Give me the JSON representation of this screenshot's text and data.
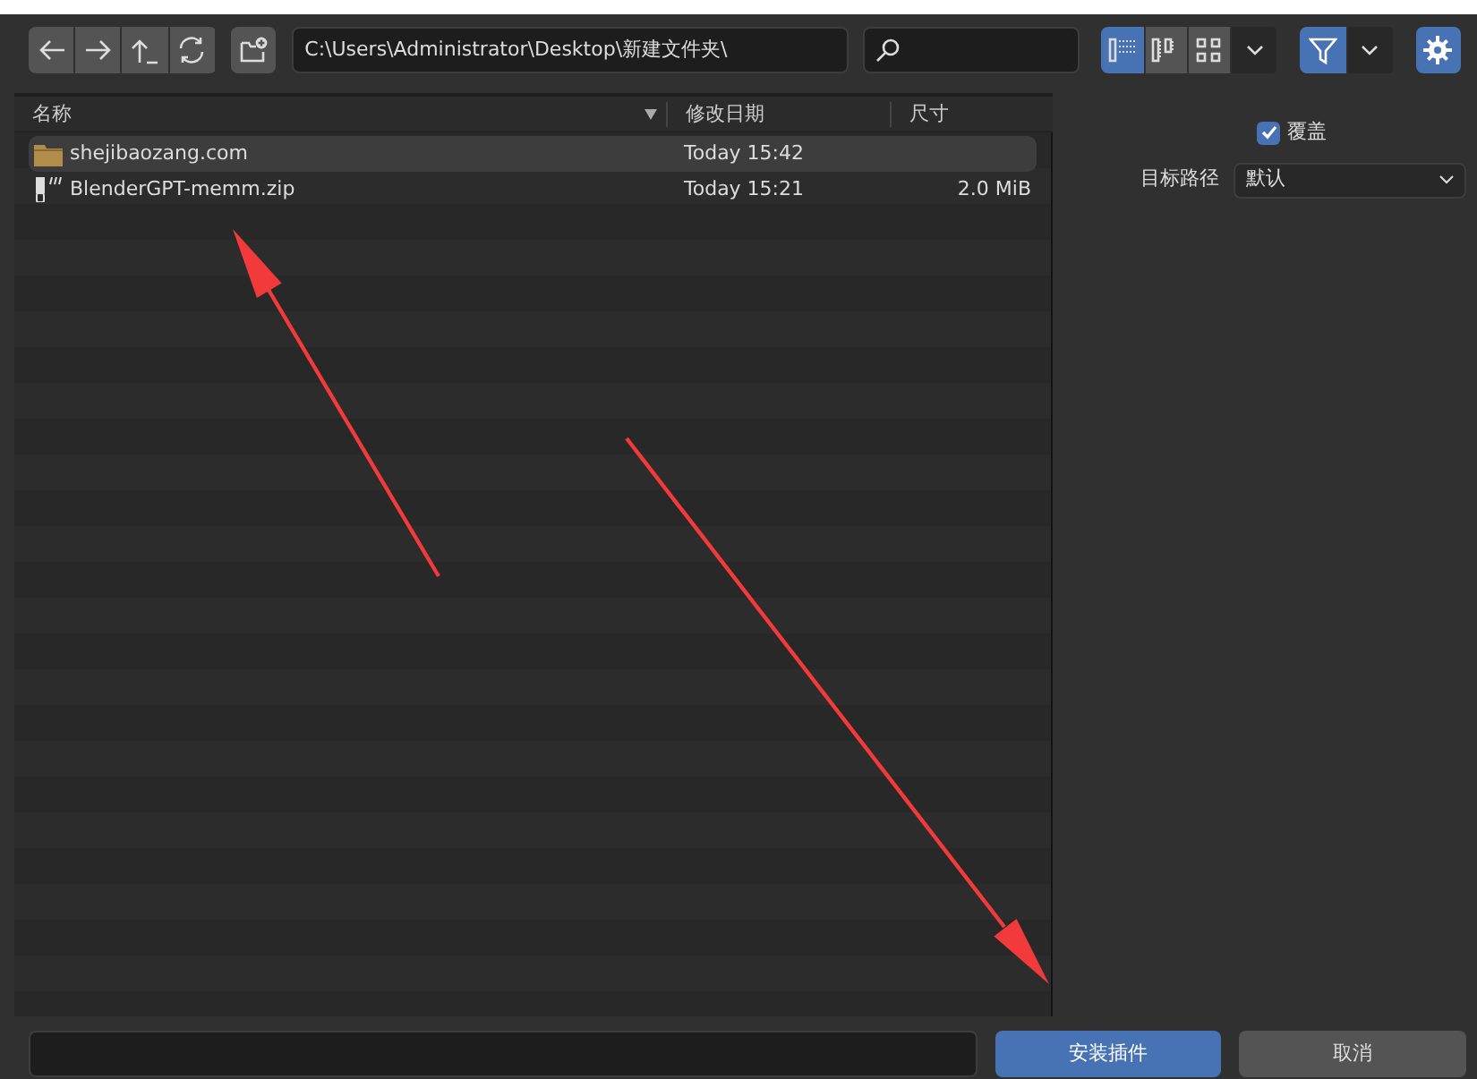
{
  "toolbar": {
    "path": "C:\\Users\\Administrator\\Desktop\\新建文件夹\\",
    "view_modes": [
      {
        "kind": "vertical-list",
        "selected": true
      },
      {
        "kind": "horizontal-list",
        "selected": false
      },
      {
        "kind": "thumbnails",
        "selected": false
      }
    ],
    "filter_on": true
  },
  "file_list": {
    "columns": [
      {
        "label": "名称",
        "sorted": true
      },
      {
        "label": "修改日期",
        "sorted": false
      },
      {
        "label": "尺寸",
        "sorted": false
      }
    ],
    "rows": [
      {
        "kind": "folder",
        "name": "shejibaozang.com",
        "modified": "Today 15:42",
        "selected": true
      },
      {
        "kind": "archive",
        "name": "BlenderGPT-memm.zip",
        "modified": "Today 15:21",
        "size": "2.0 MiB",
        "selected": false
      }
    ]
  },
  "options": {
    "overwrite": {
      "label": "覆盖",
      "checked": true
    },
    "target_path": {
      "label": "目标路径",
      "value": "默认"
    }
  },
  "buttons": [
    {
      "label": "安装插件",
      "kind": "primary"
    },
    {
      "label": "取消",
      "kind": "secondary"
    }
  ]
}
